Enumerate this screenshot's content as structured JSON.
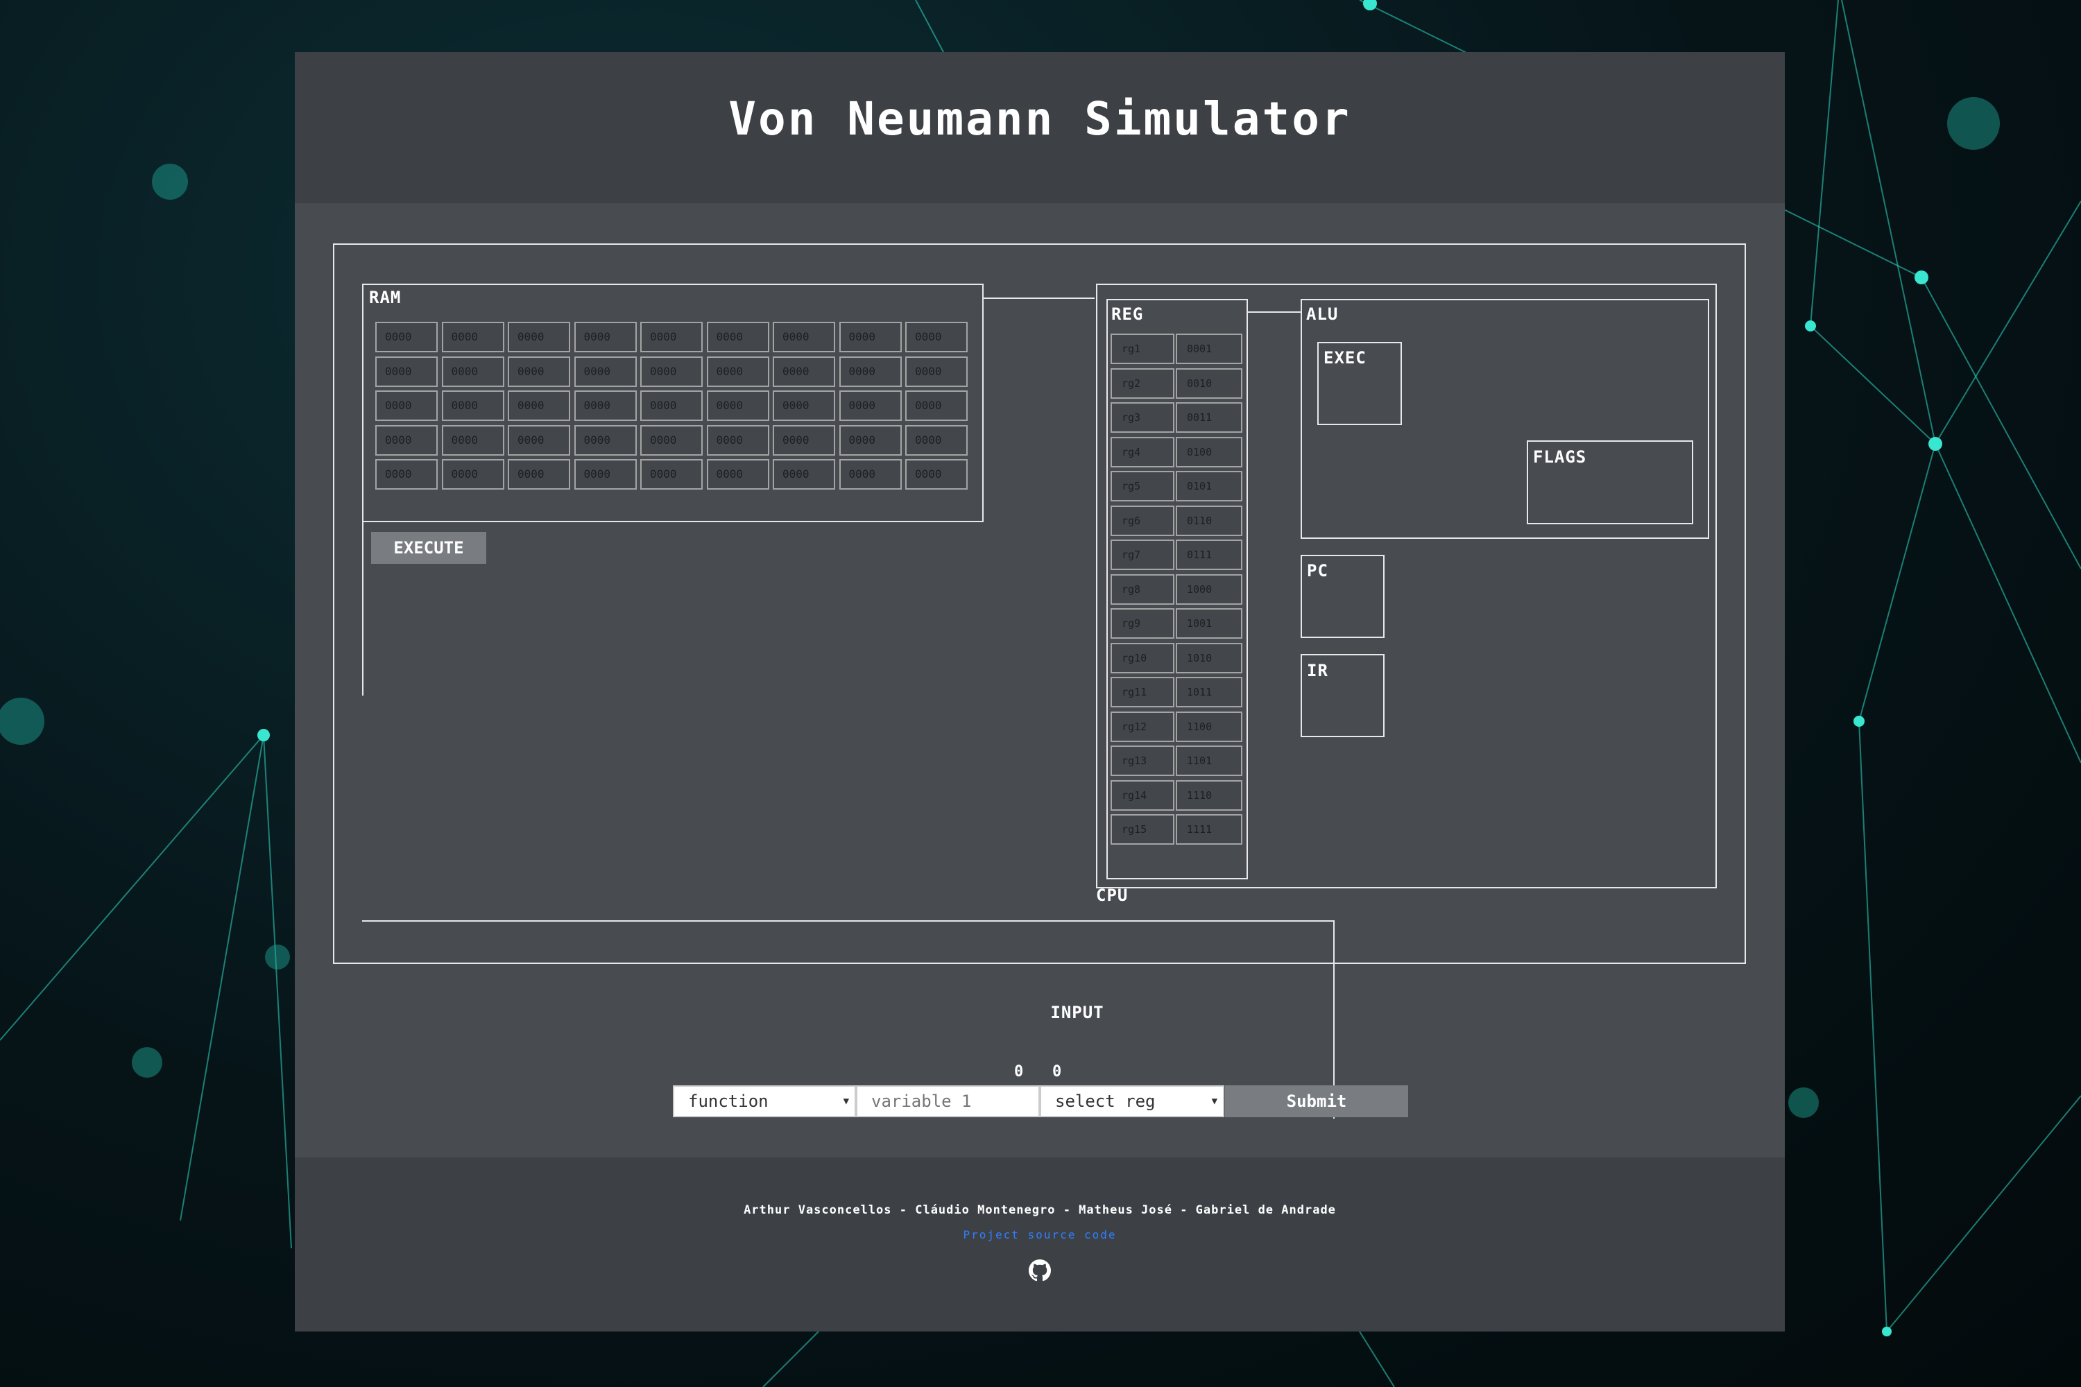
{
  "app": {
    "title": "Von Neumann Simulator"
  },
  "ram": {
    "label": "RAM",
    "rows": [
      [
        "0000",
        "0000",
        "0000",
        "0000",
        "0000",
        "0000",
        "0000",
        "0000",
        "0000"
      ],
      [
        "0000",
        "0000",
        "0000",
        "0000",
        "0000",
        "0000",
        "0000",
        "0000",
        "0000"
      ],
      [
        "0000",
        "0000",
        "0000",
        "0000",
        "0000",
        "0000",
        "0000",
        "0000",
        "0000"
      ],
      [
        "0000",
        "0000",
        "0000",
        "0000",
        "0000",
        "0000",
        "0000",
        "0000",
        "0000"
      ],
      [
        "0000",
        "0000",
        "0000",
        "0000",
        "0000",
        "0000",
        "0000",
        "0000",
        "0000"
      ]
    ],
    "execute_label": "EXECUTE"
  },
  "cpu": {
    "label": "CPU",
    "reg": {
      "label": "REG",
      "registers": [
        {
          "name": "rg1",
          "value": "0001"
        },
        {
          "name": "rg2",
          "value": "0010"
        },
        {
          "name": "rg3",
          "value": "0011"
        },
        {
          "name": "rg4",
          "value": "0100"
        },
        {
          "name": "rg5",
          "value": "0101"
        },
        {
          "name": "rg6",
          "value": "0110"
        },
        {
          "name": "rg7",
          "value": "0111"
        },
        {
          "name": "rg8",
          "value": "1000"
        },
        {
          "name": "rg9",
          "value": "1001"
        },
        {
          "name": "rg10",
          "value": "1010"
        },
        {
          "name": "rg11",
          "value": "1011"
        },
        {
          "name": "rg12",
          "value": "1100"
        },
        {
          "name": "rg13",
          "value": "1101"
        },
        {
          "name": "rg14",
          "value": "1110"
        },
        {
          "name": "rg15",
          "value": "1111"
        }
      ]
    },
    "alu": {
      "label": "ALU",
      "exec_label": "EXEC",
      "flags_label": "FLAGS"
    },
    "pc_label": "PC",
    "ir_label": "IR"
  },
  "input": {
    "label": "INPUT",
    "bits": [
      "0",
      "0"
    ],
    "function_select": {
      "value": "function"
    },
    "variable_input": {
      "placeholder": "variable 1"
    },
    "reg_select": {
      "value": "select reg"
    },
    "submit_label": "Submit"
  },
  "footer": {
    "authors": "Arthur Vasconcellos - Cláudio Montenegro - Matheus José - Gabriel de Andrade",
    "source_link": "Project source code",
    "icon": "github-icon"
  },
  "colors": {
    "panel": "#484c51",
    "header": "#3d4045",
    "button": "#797c81",
    "link": "#2f7fff",
    "accent_bg": "#1fd6c0"
  }
}
